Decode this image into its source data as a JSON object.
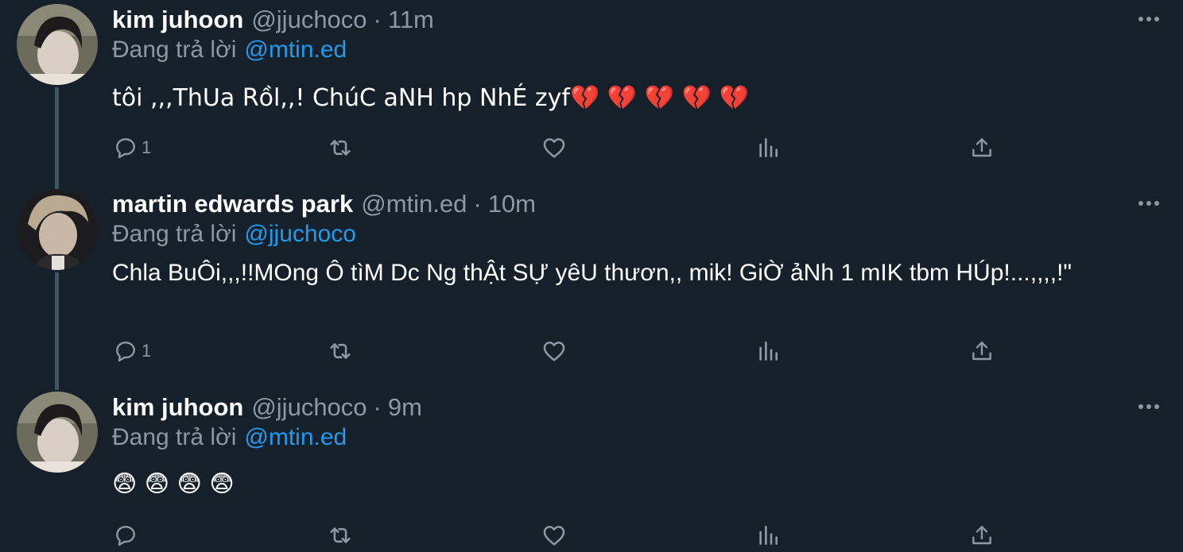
{
  "tweets": [
    {
      "name": "kim juhoon",
      "handle": "@jjuchoco",
      "separator": "·",
      "time": "11m",
      "replying_label": "Đang trả lời",
      "replying_to": "@mtin.ed",
      "text": "tôi ,,,ThUa Rồl,,! ChúC aNH hp NhÉ zyf💔 💔 💔 💔 💔",
      "reply_count": "1"
    },
    {
      "name": "martin edwards park",
      "handle": "@mtin.ed",
      "separator": "·",
      "time": "10m",
      "replying_label": "Đang trả lời",
      "replying_to": "@jjuchoco",
      "text": "Chla BuÔi,,,!!MOng Ô tìM Dc Ng thẬt SỰ yêU thươn,, mik! GiỜ ảNh 1 mIK tbm HÚp!...,,,,!\"",
      "reply_count": "1"
    },
    {
      "name": "kim juhoon",
      "handle": "@jjuchoco",
      "separator": "·",
      "time": "9m",
      "replying_label": "Đang trả lời",
      "replying_to": "@mtin.ed",
      "text": "😨 😨 😨 😨",
      "reply_count": ""
    }
  ],
  "icons": {
    "more": "more-icon",
    "reply": "reply-icon",
    "retweet": "retweet-icon",
    "like": "like-icon",
    "analytics": "analytics-icon",
    "share": "share-icon"
  },
  "colors": {
    "background": "#15202b",
    "text": "#ffffff",
    "muted": "#8b98a5",
    "link": "#1d9bf0",
    "thread_line": "#3d5466"
  }
}
